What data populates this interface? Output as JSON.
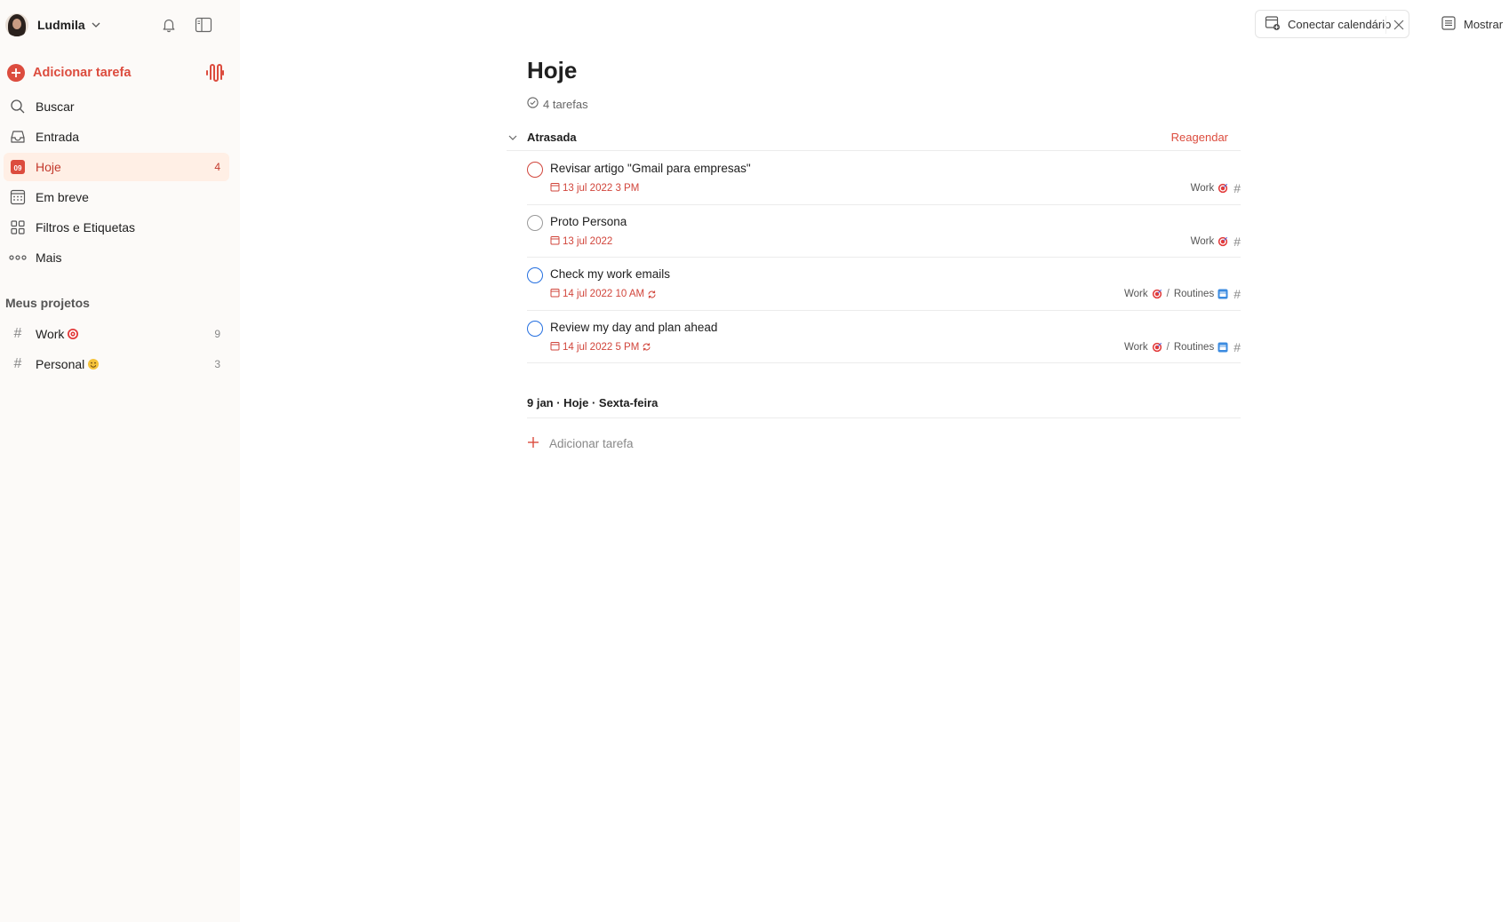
{
  "user": {
    "name": "Ludmila"
  },
  "sidebar": {
    "add_task_label": "Adicionar tarefa",
    "nav": [
      {
        "label": "Buscar",
        "icon": "search-icon"
      },
      {
        "label": "Entrada",
        "icon": "inbox-icon"
      },
      {
        "label": "Hoje",
        "icon": "today-calendar-icon",
        "count": "4",
        "active": true,
        "icon_text": "09"
      },
      {
        "label": "Em breve",
        "icon": "upcoming-calendar-icon"
      },
      {
        "label": "Filtros e Etiquetas",
        "icon": "filters-grid-icon"
      },
      {
        "label": "Mais",
        "icon": "more-dots-icon"
      }
    ],
    "projects_title": "Meus projetos",
    "projects": [
      {
        "label": "Work",
        "emoji": "target",
        "count": "9"
      },
      {
        "label": "Personal",
        "emoji": "smiley",
        "count": "3"
      }
    ]
  },
  "header": {
    "connect_calendar": "Conectar calendário",
    "show": "Mostrar"
  },
  "main": {
    "title": "Hoje",
    "task_count": "4 tarefas",
    "overdue_section": "Atrasada",
    "reschedule": "Reagendar",
    "tasks": [
      {
        "name": "Revisar artigo \"Gmail para empresas\"",
        "due": "13 jul 2022 3 PM",
        "priority": "p1",
        "recurring": false,
        "project": "Work",
        "section": ""
      },
      {
        "name": "Proto Persona",
        "due": "13 jul 2022",
        "priority": "p4",
        "recurring": false,
        "project": "Work",
        "section": ""
      },
      {
        "name": "Check my work emails",
        "due": "14 jul 2022 10 AM",
        "priority": "p2",
        "recurring": true,
        "project": "Work",
        "section": "Routines"
      },
      {
        "name": "Review my day and plan ahead",
        "due": "14 jul 2022 5 PM",
        "priority": "p2",
        "recurring": true,
        "project": "Work",
        "section": "Routines"
      }
    ],
    "day_section": "9 jan · Hoje · Sexta-feira",
    "add_task_inline": "Adicionar tarefa"
  },
  "colors": {
    "accent": "#dc4c3e",
    "priority_1": "#d1453b",
    "priority_2": "#246fe0",
    "sidebar_bg": "#fcfaf8",
    "active_bg": "#ffefe5"
  }
}
